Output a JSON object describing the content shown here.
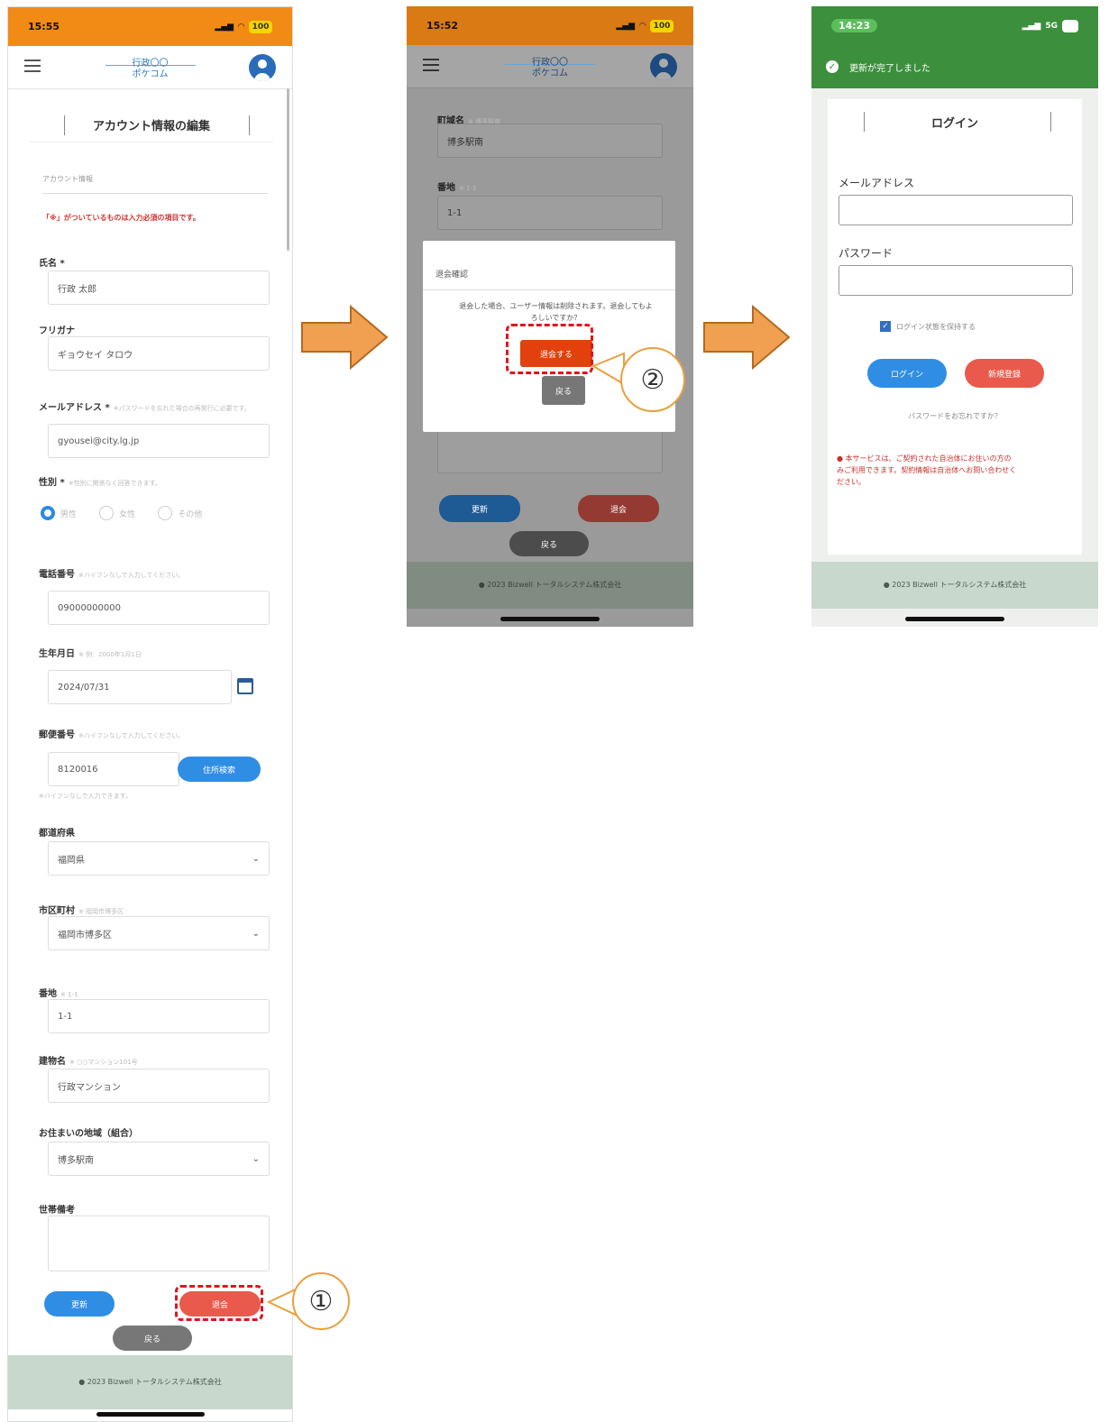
{
  "status": {
    "time1": "15:55",
    "time2": "15:52",
    "time3": "14:23",
    "battery": "100",
    "signal3": "5G"
  },
  "app": {
    "logo_small": "行政〇〇",
    "logo_text": "ポケコム",
    "footer": "2023 Bizwell トータルシステム株式会社"
  },
  "screen1": {
    "title": "アカウント情報の編集",
    "section": "アカウント情報",
    "required_note": "「※」がついているものは入力必須の項目です。",
    "fields": {
      "name_label": "氏名 *",
      "name_value": "行政 太郎",
      "kana_label": "フリガナ",
      "kana_value": "ギョウセイ タロウ",
      "email_label": "メールアドレス *",
      "email_hint": "※パスワードを忘れた場合の再発行に必要です。",
      "email_value": "gyousei@city.lg.jp",
      "gender_label": "性別 *",
      "gender_hint": "※性別に関係なく回答できます。",
      "gender_options": [
        "男性",
        "女性",
        "その他"
      ],
      "phone_label": "電話番号",
      "phone_hint": "※ハイフンなしで入力してください。",
      "phone_value": "09000000000",
      "birth_label": "生年月日",
      "birth_hint": "※ 例：2000年1月1日",
      "birth_value": "2024/07/31",
      "zip_label": "郵便番号",
      "zip_hint": "※ハイフンなしで入力してください。",
      "zip_value": "8120016",
      "zip_button": "住所検索",
      "zip_note": "※ハイフンなしで入力できます。",
      "pref_label": "都道府県",
      "pref_value": "福岡県",
      "city_label": "市区町村",
      "city_hint": "※ 福岡市博多区",
      "city_value": "福岡市博多区",
      "block_label": "番地",
      "block_hint": "※ 1-1",
      "block_value": "1-1",
      "building_label": "建物名",
      "building_hint": "※ ○○マンション101号",
      "building_value": "行政マンション",
      "area_label": "お住まいの地域（組合）",
      "area_value": "博多駅南",
      "memo_label": "世帯備考"
    },
    "buttons": {
      "update": "更新",
      "withdraw": "退会",
      "back": "戻る"
    },
    "callout": "①"
  },
  "screen2": {
    "town_label": "町域名",
    "town_hint": "※ 博多駅南",
    "town_value": "博多駅南",
    "block_label": "番地",
    "block_hint": "※ 1-1",
    "block_value": "1-1",
    "modal_title": "退会確認",
    "modal_message": "退会した場合、ユーザー情報は削除されます。退会してもよろしいですか？",
    "modal_confirm": "退会する",
    "modal_cancel": "戻る",
    "buttons": {
      "update": "更新",
      "withdraw": "退会",
      "back": "戻る"
    },
    "callout": "②"
  },
  "screen3": {
    "toast": "更新が完了しました",
    "title": "ログイン",
    "email_label": "メールアドレス",
    "password_label": "パスワード",
    "remember": "ログイン状態を保持する",
    "login_button": "ログイン",
    "register_button": "新規登録",
    "forgot": "パスワードをお忘れですか？",
    "notice": "本サービスは、ご契約された自治体にお住いの方のみご利用できます。契約情報は自治体へお問い合わせください。"
  },
  "colors": {
    "statusbar": "#f28a16",
    "statusbar_success": "#3c8f3c",
    "primary": "#2f8de4",
    "danger": "#e95a4c",
    "accent_arrow": "#f0a050"
  }
}
